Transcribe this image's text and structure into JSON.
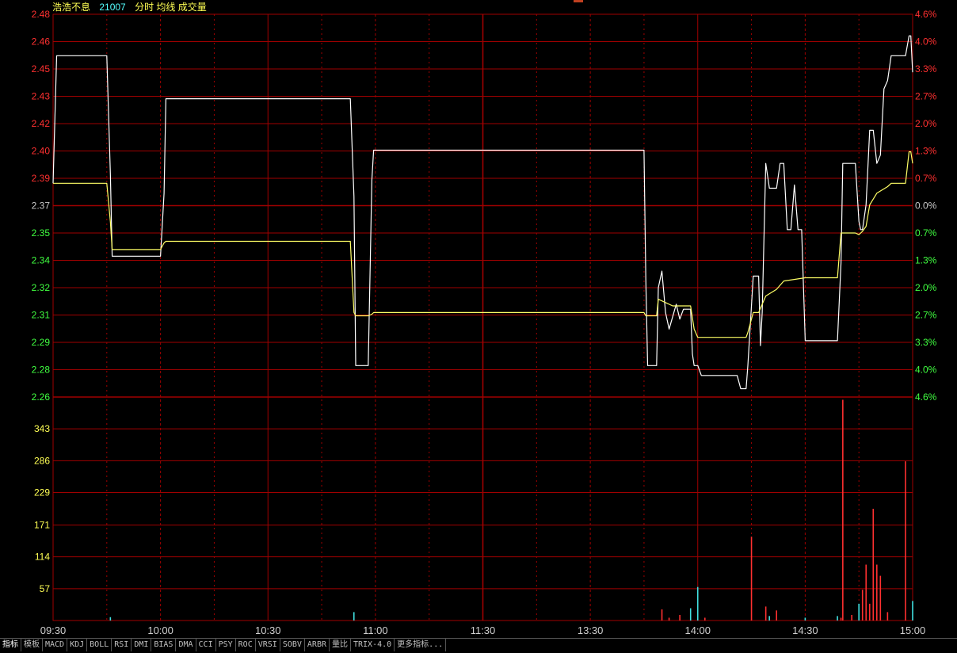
{
  "header": {
    "stock_name": "浩浩不息",
    "stock_code": "21007",
    "indicators": "分时 均线 成交量"
  },
  "colors": {
    "background": "#000000",
    "grid": "#a00000",
    "price_line": "#ffffff",
    "avg_line": "#ffff66",
    "up": "#ff3030",
    "down": "#40ff40",
    "neutral": "#c8c8c8",
    "volume_axis": "#ffff54"
  },
  "chart_data": [
    {
      "type": "line",
      "title": "分时",
      "y_ticks": [
        {
          "label": "2.48",
          "value": 2.48,
          "color": "up"
        },
        {
          "label": "2.46",
          "value": 2.4635,
          "color": "up"
        },
        {
          "label": "2.45",
          "value": 2.447,
          "color": "up"
        },
        {
          "label": "2.43",
          "value": 2.4305,
          "color": "up"
        },
        {
          "label": "2.42",
          "value": 2.414,
          "color": "up"
        },
        {
          "label": "2.40",
          "value": 2.3975,
          "color": "up"
        },
        {
          "label": "2.39",
          "value": 2.381,
          "color": "up"
        },
        {
          "label": "2.37",
          "value": 2.3645,
          "color": "neutral"
        },
        {
          "label": "2.35",
          "value": 2.348,
          "color": "down"
        },
        {
          "label": "2.34",
          "value": 2.3315,
          "color": "down"
        },
        {
          "label": "2.32",
          "value": 2.315,
          "color": "down"
        },
        {
          "label": "2.31",
          "value": 2.2985,
          "color": "down"
        },
        {
          "label": "2.29",
          "value": 2.282,
          "color": "down"
        },
        {
          "label": "2.28",
          "value": 2.2655,
          "color": "down"
        },
        {
          "label": "2.26",
          "value": 2.249,
          "color": "down"
        }
      ],
      "pct_ticks": [
        "4.6%",
        "4.0%",
        "3.3%",
        "2.7%",
        "2.0%",
        "1.3%",
        "0.7%",
        "0.0%",
        "0.7%",
        "1.3%",
        "2.0%",
        "2.7%",
        "3.3%",
        "4.0%",
        "4.6%"
      ],
      "x_ticks": [
        {
          "label": "09:30",
          "t": 0
        },
        {
          "label": "10:00",
          "t": 30
        },
        {
          "label": "10:30",
          "t": 60
        },
        {
          "label": "11:00",
          "t": 90
        },
        {
          "label": "11:30",
          "t": 120
        },
        {
          "label": "13:30",
          "t": 150
        },
        {
          "label": "14:00",
          "t": 180
        },
        {
          "label": "14:30",
          "t": 210
        },
        {
          "label": "15:00",
          "t": 240
        }
      ],
      "ylim": [
        2.249,
        2.48
      ],
      "xlim": [
        0,
        240
      ],
      "series": [
        {
          "key": "price",
          "color": "price_line",
          "points": [
            [
              0,
              2.378
            ],
            [
              1,
              2.455
            ],
            [
              15,
              2.455
            ],
            [
              16,
              2.384
            ],
            [
              16.5,
              2.334
            ],
            [
              30,
              2.334
            ],
            [
              31,
              2.372
            ],
            [
              31.5,
              2.429
            ],
            [
              83,
              2.429
            ],
            [
              84,
              2.37
            ],
            [
              84.5,
              2.268
            ],
            [
              88,
              2.268
            ],
            [
              89,
              2.38
            ],
            [
              89.5,
              2.398
            ],
            [
              165,
              2.398
            ],
            [
              165.5,
              2.32
            ],
            [
              166,
              2.268
            ],
            [
              168.5,
              2.268
            ],
            [
              169,
              2.315
            ],
            [
              170,
              2.325
            ],
            [
              171,
              2.3
            ],
            [
              172,
              2.29
            ],
            [
              174,
              2.305
            ],
            [
              175,
              2.296
            ],
            [
              176,
              2.302
            ],
            [
              178,
              2.302
            ],
            [
              178.5,
              2.275
            ],
            [
              179,
              2.268
            ],
            [
              180,
              2.268
            ],
            [
              181,
              2.262
            ],
            [
              191,
              2.262
            ],
            [
              192,
              2.254
            ],
            [
              193.5,
              2.254
            ],
            [
              194,
              2.268
            ],
            [
              195.5,
              2.322
            ],
            [
              197,
              2.322
            ],
            [
              197.5,
              2.28
            ],
            [
              198,
              2.3
            ],
            [
              199,
              2.39
            ],
            [
              200,
              2.375
            ],
            [
              202,
              2.375
            ],
            [
              203,
              2.39
            ],
            [
              204,
              2.39
            ],
            [
              205,
              2.35
            ],
            [
              206,
              2.35
            ],
            [
              207,
              2.377
            ],
            [
              208,
              2.35
            ],
            [
              209,
              2.35
            ],
            [
              210,
              2.283
            ],
            [
              219,
              2.283
            ],
            [
              220,
              2.33
            ],
            [
              220.5,
              2.39
            ],
            [
              224,
              2.39
            ],
            [
              225,
              2.355
            ],
            [
              225.5,
              2.35
            ],
            [
              226,
              2.35
            ],
            [
              227,
              2.365
            ],
            [
              228,
              2.41
            ],
            [
              229,
              2.41
            ],
            [
              230,
              2.39
            ],
            [
              231,
              2.395
            ],
            [
              232,
              2.435
            ],
            [
              233,
              2.44
            ],
            [
              234,
              2.455
            ],
            [
              238,
              2.455
            ],
            [
              239,
              2.467
            ],
            [
              239.5,
              2.467
            ],
            [
              240,
              2.445
            ]
          ]
        },
        {
          "key": "avg",
          "color": "avg_line",
          "points": [
            [
              0,
              2.378
            ],
            [
              15,
              2.378
            ],
            [
              16,
              2.355
            ],
            [
              16.5,
              2.338
            ],
            [
              30,
              2.338
            ],
            [
              31,
              2.342
            ],
            [
              31.5,
              2.343
            ],
            [
              83,
              2.343
            ],
            [
              84,
              2.3
            ],
            [
              84.5,
              2.298
            ],
            [
              88,
              2.298
            ],
            [
              89,
              2.299
            ],
            [
              89.5,
              2.3
            ],
            [
              165,
              2.3
            ],
            [
              165.5,
              2.298
            ],
            [
              168.5,
              2.298
            ],
            [
              169,
              2.308
            ],
            [
              171,
              2.306
            ],
            [
              173,
              2.304
            ],
            [
              178,
              2.304
            ],
            [
              179,
              2.29
            ],
            [
              180,
              2.285
            ],
            [
              193.5,
              2.285
            ],
            [
              194,
              2.288
            ],
            [
              195.5,
              2.3
            ],
            [
              197,
              2.3
            ],
            [
              199,
              2.31
            ],
            [
              202,
              2.314
            ],
            [
              204,
              2.319
            ],
            [
              210,
              2.321
            ],
            [
              219,
              2.321
            ],
            [
              220,
              2.348
            ],
            [
              224,
              2.348
            ],
            [
              225,
              2.347
            ],
            [
              226,
              2.349
            ],
            [
              227,
              2.352
            ],
            [
              228,
              2.365
            ],
            [
              230,
              2.372
            ],
            [
              233,
              2.376
            ],
            [
              234,
              2.378
            ],
            [
              238,
              2.378
            ],
            [
              239,
              2.397
            ],
            [
              239.5,
              2.397
            ],
            [
              240,
              2.39
            ]
          ]
        }
      ]
    },
    {
      "type": "bar",
      "title": "成交量",
      "y_ticks": [
        "343",
        "286",
        "229",
        "171",
        "114",
        "57"
      ],
      "y_tick_values": [
        343,
        286,
        229,
        171,
        114,
        57
      ],
      "ylim": [
        0,
        400
      ],
      "bars": [
        {
          "t": 16,
          "v": 6,
          "color": "cyan"
        },
        {
          "t": 84,
          "v": 15,
          "color": "cyan"
        },
        {
          "t": 170,
          "v": 20,
          "color": "up"
        },
        {
          "t": 172,
          "v": 5,
          "color": "up"
        },
        {
          "t": 175,
          "v": 10,
          "color": "up"
        },
        {
          "t": 178,
          "v": 22,
          "color": "cyan"
        },
        {
          "t": 180,
          "v": 60,
          "color": "cyan"
        },
        {
          "t": 182,
          "v": 5,
          "color": "up"
        },
        {
          "t": 195,
          "v": 150,
          "color": "up"
        },
        {
          "t": 199,
          "v": 25,
          "color": "up"
        },
        {
          "t": 200,
          "v": 8,
          "color": "cyan"
        },
        {
          "t": 202,
          "v": 18,
          "color": "up"
        },
        {
          "t": 210,
          "v": 5,
          "color": "cyan"
        },
        {
          "t": 219,
          "v": 8,
          "color": "cyan"
        },
        {
          "t": 220,
          "v": 5,
          "color": "up"
        },
        {
          "t": 220.5,
          "v": 395,
          "color": "up"
        },
        {
          "t": 223,
          "v": 10,
          "color": "up"
        },
        {
          "t": 225,
          "v": 30,
          "color": "cyan"
        },
        {
          "t": 226,
          "v": 55,
          "color": "up"
        },
        {
          "t": 227,
          "v": 100,
          "color": "up"
        },
        {
          "t": 228,
          "v": 30,
          "color": "up"
        },
        {
          "t": 229,
          "v": 200,
          "color": "up"
        },
        {
          "t": 230,
          "v": 100,
          "color": "up"
        },
        {
          "t": 231,
          "v": 80,
          "color": "up"
        },
        {
          "t": 233,
          "v": 15,
          "color": "up"
        },
        {
          "t": 238,
          "v": 285,
          "color": "up"
        },
        {
          "t": 240,
          "v": 35,
          "color": "cyan"
        }
      ]
    }
  ],
  "toolbar": {
    "tabs": [
      "指标",
      "模板",
      "MACD",
      "KDJ",
      "BOLL",
      "RSI",
      "DMI",
      "BIAS",
      "DMA",
      "CCI",
      "PSY",
      "ROC",
      "VRSI",
      "SOBV",
      "ARBR",
      "量比",
      "TRIX-4.0",
      "更多指标..."
    ],
    "active_index": 0
  }
}
